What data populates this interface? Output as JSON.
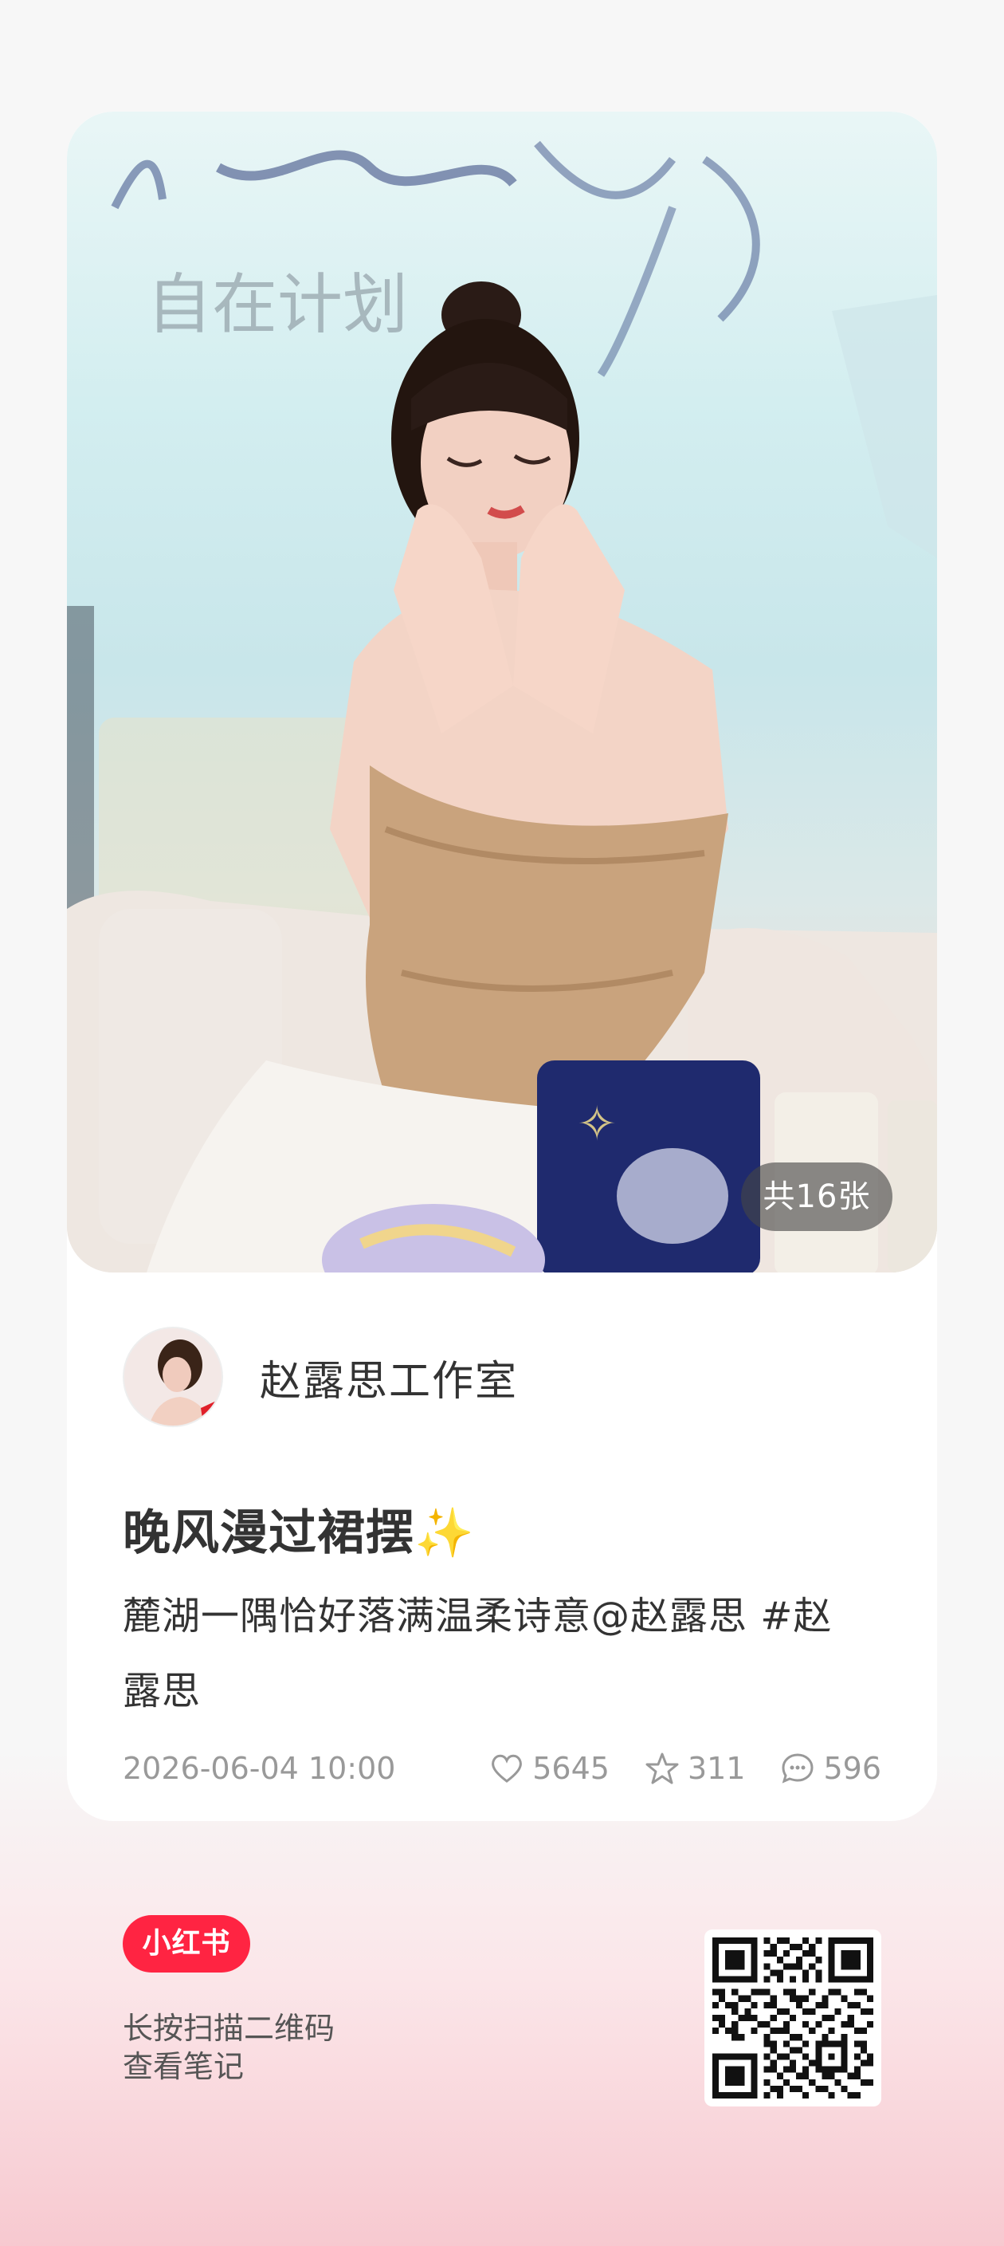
{
  "photo": {
    "count_label": "共16张",
    "background_lettering": "自在计划"
  },
  "author": {
    "name": "赵露思工作室",
    "avatar_icon": "person-avatar-icon"
  },
  "note": {
    "title": "晚风漫过裙摆✨",
    "description_line1": "麓湖一隅恰好落满温柔诗意@赵露思 #赵",
    "description_line2": "露思",
    "date": "2026-06-04 10:00",
    "likes": "5645",
    "stars": "311",
    "comments": "596"
  },
  "footer": {
    "logo_label": "小红书",
    "hint_line1": "长按扫描二维码",
    "hint_line2": "查看笔记"
  },
  "colors": {
    "brand_red": "#ff2442",
    "text_primary": "#333333",
    "text_meta": "#999999"
  }
}
